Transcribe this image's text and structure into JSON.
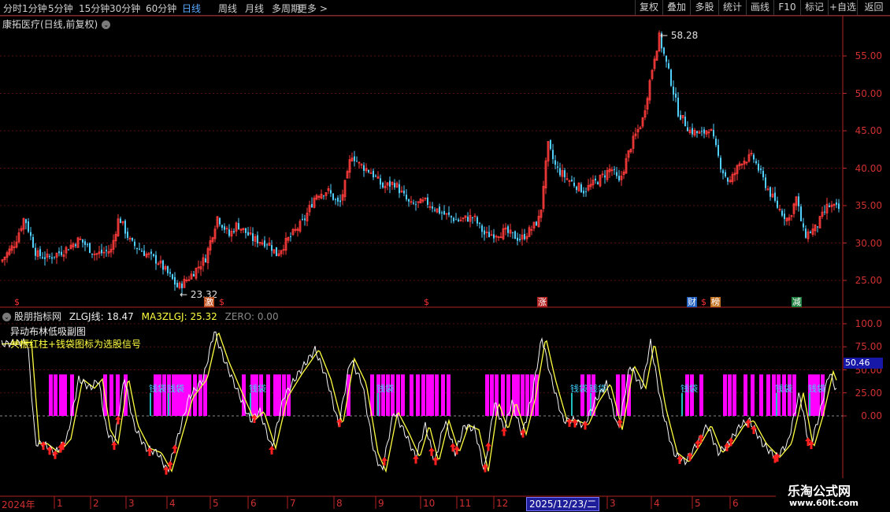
{
  "toolbar": {
    "timeframes": [
      "分时",
      "1分钟",
      "5分钟",
      "15分钟",
      "30分钟",
      "60分钟",
      "日线",
      "周线",
      "月线",
      "多周期",
      "更多 >"
    ],
    "active": "日线",
    "right_buttons": [
      "复权",
      "叠加",
      "多股",
      "统计",
      "画线",
      "F10",
      "标记",
      "+自选",
      "返回"
    ]
  },
  "main_chart": {
    "title": "康拓医疗(日线,前复权)",
    "high_label": "58.28",
    "low_label": "23.32",
    "y_ticks": [
      "55.00",
      "50.00",
      "45.00",
      "40.00",
      "35.00",
      "30.00",
      "25.00"
    ],
    "event_markers": [
      "$",
      "激",
      "$",
      "$",
      "涨",
      "财",
      "$",
      "榜",
      "减"
    ]
  },
  "indicator": {
    "title": "股朋指标网",
    "zlgj": "ZLGJ线: 18.47",
    "ma3": "MA3ZLGJ: 25.32",
    "zero": "ZERO: 0.00",
    "note1": "异动布林低吸副图",
    "note2": "共振红柱+钱袋图标为选股信号",
    "y_ticks": [
      "100.0",
      "75.00",
      "50.00",
      "25.00",
      "0.00"
    ],
    "current_value": "50.46",
    "qiandai_label": "钱袋"
  },
  "x_axis": {
    "year_label": "2024年",
    "months": [
      "1",
      "2",
      "3",
      "4",
      "5",
      "6",
      "7",
      "8",
      "9",
      "10",
      "11",
      "12",
      "3",
      "4",
      "5",
      "6"
    ],
    "cursor_date": "2025/12/23/二"
  },
  "watermark": {
    "line1": "乐淘公式网",
    "line2": "www.60lt.com"
  },
  "colors": {
    "up": "#ff3b3b",
    "down": "#50d0ff",
    "magenta": "#ff00ff",
    "yellow": "#ffff40",
    "axis_red": "#c02828"
  },
  "chart_data": {
    "type": "candlestick",
    "price_anchor_points": [
      {
        "t": 0,
        "p": 27.5
      },
      {
        "t": 18,
        "p": 30
      },
      {
        "t": 30,
        "p": 33.5
      },
      {
        "t": 45,
        "p": 28.5
      },
      {
        "t": 60,
        "p": 28
      },
      {
        "t": 80,
        "p": 29
      },
      {
        "t": 100,
        "p": 30.5
      },
      {
        "t": 120,
        "p": 28.5
      },
      {
        "t": 140,
        "p": 29
      },
      {
        "t": 150,
        "p": 33.5
      },
      {
        "t": 165,
        "p": 30
      },
      {
        "t": 185,
        "p": 28.5
      },
      {
        "t": 200,
        "p": 27.5
      },
      {
        "t": 215,
        "p": 25.5
      },
      {
        "t": 225,
        "p": 24
      },
      {
        "t": 240,
        "p": 25.5
      },
      {
        "t": 260,
        "p": 28
      },
      {
        "t": 275,
        "p": 33.5
      },
      {
        "t": 290,
        "p": 31
      },
      {
        "t": 300,
        "p": 32.5
      },
      {
        "t": 320,
        "p": 30.5
      },
      {
        "t": 340,
        "p": 30
      },
      {
        "t": 350,
        "p": 28.5
      },
      {
        "t": 365,
        "p": 30.5
      },
      {
        "t": 385,
        "p": 33
      },
      {
        "t": 400,
        "p": 36.5
      },
      {
        "t": 415,
        "p": 37
      },
      {
        "t": 430,
        "p": 35
      },
      {
        "t": 440,
        "p": 39
      },
      {
        "t": 445,
        "p": 42
      },
      {
        "t": 455,
        "p": 40.5
      },
      {
        "t": 470,
        "p": 39.5
      },
      {
        "t": 485,
        "p": 37.5
      },
      {
        "t": 500,
        "p": 38
      },
      {
        "t": 520,
        "p": 35
      },
      {
        "t": 540,
        "p": 35.5
      },
      {
        "t": 560,
        "p": 34
      },
      {
        "t": 580,
        "p": 33
      },
      {
        "t": 600,
        "p": 33.5
      },
      {
        "t": 615,
        "p": 31
      },
      {
        "t": 640,
        "p": 31.5
      },
      {
        "t": 660,
        "p": 30.5
      },
      {
        "t": 675,
        "p": 32
      },
      {
        "t": 685,
        "p": 33.5
      },
      {
        "t": 688,
        "p": 37
      },
      {
        "t": 695,
        "p": 43
      },
      {
        "t": 705,
        "p": 40
      },
      {
        "t": 720,
        "p": 38.5
      },
      {
        "t": 740,
        "p": 37
      },
      {
        "t": 760,
        "p": 38.5
      },
      {
        "t": 775,
        "p": 40
      },
      {
        "t": 785,
        "p": 38
      },
      {
        "t": 800,
        "p": 43
      },
      {
        "t": 815,
        "p": 46.5
      },
      {
        "t": 830,
        "p": 55
      },
      {
        "t": 836,
        "p": 57.5
      },
      {
        "t": 850,
        "p": 52
      },
      {
        "t": 860,
        "p": 47.5
      },
      {
        "t": 875,
        "p": 45
      },
      {
        "t": 890,
        "p": 44.5
      },
      {
        "t": 900,
        "p": 45.5
      },
      {
        "t": 915,
        "p": 40
      },
      {
        "t": 925,
        "p": 38
      },
      {
        "t": 940,
        "p": 41
      },
      {
        "t": 955,
        "p": 41.5
      },
      {
        "t": 970,
        "p": 38
      },
      {
        "t": 985,
        "p": 35
      },
      {
        "t": 1000,
        "p": 33
      },
      {
        "t": 1010,
        "p": 36
      },
      {
        "t": 1020,
        "p": 31
      },
      {
        "t": 1035,
        "p": 32
      },
      {
        "t": 1050,
        "p": 35
      },
      {
        "t": 1065,
        "p": 34.5
      }
    ],
    "price_range": [
      22,
      59
    ],
    "indicator_anchor_points": [
      {
        "t": 0,
        "v": 78
      },
      {
        "t": 35,
        "v": 80
      },
      {
        "t": 45,
        "v": -30
      },
      {
        "t": 55,
        "v": -30
      },
      {
        "t": 70,
        "v": -40
      },
      {
        "t": 85,
        "v": -25
      },
      {
        "t": 100,
        "v": 40
      },
      {
        "t": 115,
        "v": 30
      },
      {
        "t": 125,
        "v": 40
      },
      {
        "t": 135,
        "v": -15
      },
      {
        "t": 145,
        "v": -30
      },
      {
        "t": 158,
        "v": 42
      },
      {
        "t": 170,
        "v": -10
      },
      {
        "t": 185,
        "v": -35
      },
      {
        "t": 200,
        "v": -40
      },
      {
        "t": 213,
        "v": -60
      },
      {
        "t": 225,
        "v": -25
      },
      {
        "t": 240,
        "v": 20
      },
      {
        "t": 258,
        "v": 40
      },
      {
        "t": 272,
        "v": 92
      },
      {
        "t": 285,
        "v": 60
      },
      {
        "t": 300,
        "v": 30
      },
      {
        "t": 318,
        "v": -5
      },
      {
        "t": 330,
        "v": 5
      },
      {
        "t": 345,
        "v": -35
      },
      {
        "t": 360,
        "v": 20
      },
      {
        "t": 378,
        "v": 45
      },
      {
        "t": 400,
        "v": 72
      },
      {
        "t": 415,
        "v": 40
      },
      {
        "t": 430,
        "v": -10
      },
      {
        "t": 445,
        "v": 62
      },
      {
        "t": 460,
        "v": 35
      },
      {
        "t": 475,
        "v": -40
      },
      {
        "t": 485,
        "v": -60
      },
      {
        "t": 500,
        "v": 5
      },
      {
        "t": 515,
        "v": -20
      },
      {
        "t": 528,
        "v": -45
      },
      {
        "t": 540,
        "v": -10
      },
      {
        "t": 552,
        "v": -50
      },
      {
        "t": 565,
        "v": -5
      },
      {
        "t": 578,
        "v": -40
      },
      {
        "t": 590,
        "v": -10
      },
      {
        "t": 603,
        "v": -15
      },
      {
        "t": 615,
        "v": -60
      },
      {
        "t": 628,
        "v": 15
      },
      {
        "t": 640,
        "v": -15
      },
      {
        "t": 650,
        "v": 15
      },
      {
        "t": 663,
        "v": -20
      },
      {
        "t": 675,
        "v": 20
      },
      {
        "t": 688,
        "v": 85
      },
      {
        "t": 700,
        "v": 40
      },
      {
        "t": 715,
        "v": -5
      },
      {
        "t": 728,
        "v": -5
      },
      {
        "t": 742,
        "v": -10
      },
      {
        "t": 755,
        "v": 15
      },
      {
        "t": 770,
        "v": 35
      },
      {
        "t": 785,
        "v": -15
      },
      {
        "t": 800,
        "v": 55
      },
      {
        "t": 815,
        "v": 30
      },
      {
        "t": 826,
        "v": 80
      },
      {
        "t": 840,
        "v": 10
      },
      {
        "t": 855,
        "v": -40
      },
      {
        "t": 870,
        "v": -50
      },
      {
        "t": 885,
        "v": -30
      },
      {
        "t": 898,
        "v": -10
      },
      {
        "t": 912,
        "v": -40
      },
      {
        "t": 925,
        "v": -30
      },
      {
        "t": 940,
        "v": -10
      },
      {
        "t": 952,
        "v": -5
      },
      {
        "t": 968,
        "v": -30
      },
      {
        "t": 985,
        "v": -45
      },
      {
        "t": 1000,
        "v": -30
      },
      {
        "t": 1015,
        "v": 25
      },
      {
        "t": 1028,
        "v": -35
      },
      {
        "t": 1040,
        "v": 0
      },
      {
        "t": 1053,
        "v": 48
      },
      {
        "t": 1063,
        "v": 25
      }
    ],
    "indicator_range": [
      -75,
      110
    ],
    "magenta_bar_x": [
      62,
      68,
      75,
      80,
      89,
      131,
      139,
      147,
      157,
      195,
      200,
      206,
      212,
      218,
      223,
      228,
      233,
      238,
      245,
      252,
      258,
      307,
      318,
      323,
      329,
      338,
      347,
      352,
      358,
      364,
      440,
      470,
      478,
      484,
      490,
      496,
      503,
      509,
      520,
      528,
      535,
      541,
      546,
      552,
      560,
      567,
      616,
      622,
      628,
      636,
      643,
      650,
      655,
      661,
      667,
      673,
      679,
      737,
      745,
      751,
      782,
      789,
      796,
      870,
      876,
      888,
      918,
      924,
      930,
      944,
      953,
      964,
      973,
      980,
      986,
      993,
      1000,
      1006,
      1026,
      1031,
      1036,
      1042
    ],
    "money_bag_x": [
      203,
      226,
      330,
      492,
      738,
      762,
      878,
      998,
      1040
    ],
    "up_arrow_x": [
      55,
      63,
      70,
      77,
      80,
      145,
      150,
      190,
      211,
      216,
      222,
      323,
      345,
      431,
      488,
      528,
      548,
      553,
      575,
      580,
      616,
      620,
      640,
      664,
      723,
      730,
      743,
      787,
      863,
      876,
      886,
      890,
      923,
      928,
      950,
      957,
      984,
      987,
      1026,
      1030
    ]
  }
}
